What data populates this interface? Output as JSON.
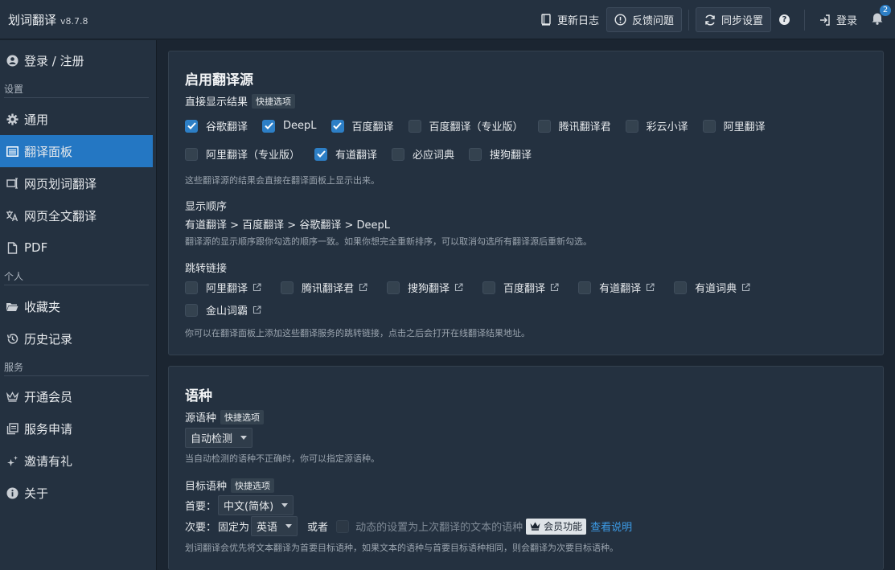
{
  "app": {
    "name": "划词翻译",
    "version": "v8.7.8"
  },
  "topbar": {
    "changelog": "更新日志",
    "feedback": "反馈问题",
    "sync": "同步设置",
    "login": "登录",
    "notif_count": "2"
  },
  "sidebar": {
    "account": "登录 / 注册",
    "section_settings": "设置",
    "general": "通用",
    "panel": "翻译面板",
    "web_select": "网页划词翻译",
    "web_full": "网页全文翻译",
    "pdf": "PDF",
    "section_personal": "个人",
    "favorites": "收藏夹",
    "history": "历史记录",
    "section_service": "服务",
    "vip": "开通会员",
    "apply": "服务申请",
    "invite": "邀请有礼",
    "about": "关于"
  },
  "sources": {
    "title": "启用翻译源",
    "direct_label": "直接显示结果",
    "quick": "快捷选项",
    "items_row1": [
      {
        "label": "谷歌翻译",
        "checked": true
      },
      {
        "label": "DeepL",
        "checked": true
      },
      {
        "label": "百度翻译",
        "checked": true
      },
      {
        "label": "百度翻译（专业版）",
        "checked": false
      },
      {
        "label": "腾讯翻译君",
        "checked": false
      },
      {
        "label": "彩云小译",
        "checked": false
      },
      {
        "label": "阿里翻译",
        "checked": false
      }
    ],
    "items_row2": [
      {
        "label": "阿里翻译（专业版）",
        "checked": false
      },
      {
        "label": "有道翻译",
        "checked": true
      },
      {
        "label": "必应词典",
        "checked": false
      },
      {
        "label": "搜狗翻译",
        "checked": false
      }
    ],
    "direct_hint": "这些翻译源的结果会直接在翻译面板上显示出来。",
    "order_label": "显示顺序",
    "order_value": "有道翻译 > 百度翻译 > 谷歌翻译 > DeepL",
    "order_hint": "翻译源的显示顺序跟你勾选的顺序一致。如果你想完全重新排序，可以取消勾选所有翻译源后重新勾选。",
    "links_label": "跳转链接",
    "links_row1": [
      "阿里翻译",
      "腾讯翻译君",
      "搜狗翻译",
      "百度翻译",
      "有道翻译",
      "有道词典"
    ],
    "links_row2": [
      "金山词霸"
    ],
    "links_hint": "你可以在翻译面板上添加这些翻译服务的跳转链接，点击之后会打开在线翻译结果地址。"
  },
  "lang": {
    "title": "语种",
    "source_label": "源语种",
    "quick": "快捷选项",
    "source_value": "自动检测",
    "source_hint": "当自动检测的语种不正确时，你可以指定源语种。",
    "target_label": "目标语种",
    "primary_label": "首要：",
    "primary_value": "中文(简体)",
    "secondary_label": "次要：",
    "fixed_label": "固定为",
    "secondary_value": "英语",
    "or_label": "或者",
    "dynamic_label": "动态的设置为上次翻译的文本的语种",
    "vip_label": "会员功能",
    "more_link": "查看说明",
    "target_hint": "划词翻译会优先将文本翻译为首要目标语种，如果文本的语种与首要目标语种相同，则会翻译为次要目标语种。"
  }
}
